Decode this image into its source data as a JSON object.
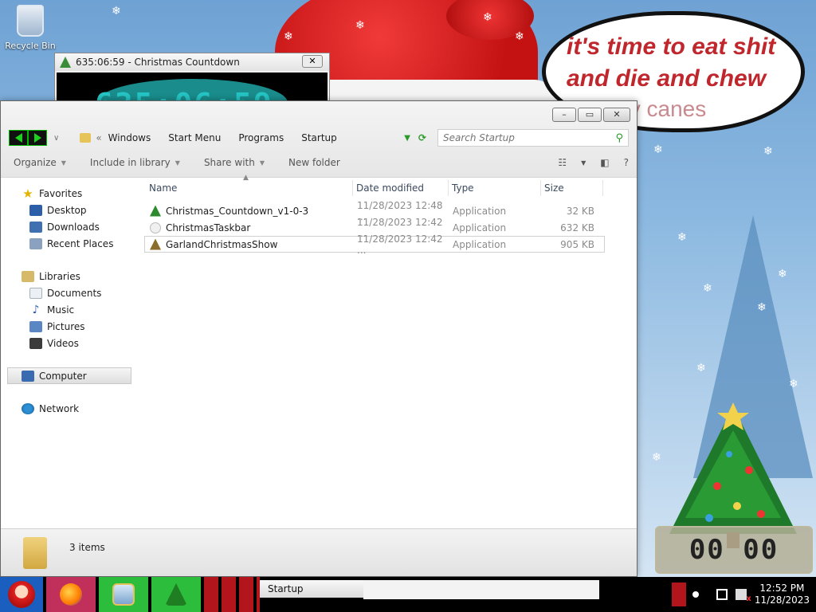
{
  "desktop": {
    "recycle_bin_label": "Recycle Bin",
    "speech_bubble": {
      "line1": "it's time to eat shit",
      "line2": "and die and chew",
      "line3": "candy canes"
    },
    "gadget_clock_text": "00 00"
  },
  "countdown_window": {
    "title": "635:06:59 - Christmas Countdown",
    "close_label": "✕",
    "display": "635:06:59"
  },
  "explorer": {
    "caption_buttons": {
      "minimize": "–",
      "maximize": "▭",
      "close": "✕"
    },
    "address": {
      "crumbs": [
        "Windows",
        "Start Menu",
        "Programs",
        "Startup"
      ]
    },
    "search": {
      "placeholder": "Search Startup"
    },
    "toolbar": {
      "organize": "Organize",
      "include_in_library": "Include in library",
      "share_with": "Share with",
      "new_folder": "New folder"
    },
    "nav": {
      "favorites": "Favorites",
      "desktop": "Desktop",
      "downloads": "Downloads",
      "recent_places": "Recent Places",
      "libraries": "Libraries",
      "documents": "Documents",
      "music": "Music",
      "pictures": "Pictures",
      "videos": "Videos",
      "computer": "Computer",
      "network": "Network"
    },
    "columns": {
      "name": "Name",
      "date_modified": "Date modified",
      "type": "Type",
      "size": "Size"
    },
    "files": [
      {
        "name": "Christmas_Countdown_v1-0-3",
        "date": "11/28/2023 12:48 ...",
        "type": "Application",
        "size": "32 KB",
        "icon": "tree-icon"
      },
      {
        "name": "ChristmasTaskbar",
        "date": "11/28/2023 12:42 ...",
        "type": "Application",
        "size": "632 KB",
        "icon": "snowflake-icon"
      },
      {
        "name": "GarlandChristmasShow",
        "date": "11/28/2023 12:42 ...",
        "type": "Application",
        "size": "905 KB",
        "icon": "garland-icon"
      }
    ],
    "status": {
      "item_count": "3 items"
    }
  },
  "taskbar": {
    "active_task": "Startup",
    "clock_time": "12:52 PM",
    "clock_date": "11/28/2023"
  },
  "colors": {
    "speech_red": "#c0272d",
    "nav_green": "#1dd01d",
    "taskbar_bg": "#000000"
  }
}
